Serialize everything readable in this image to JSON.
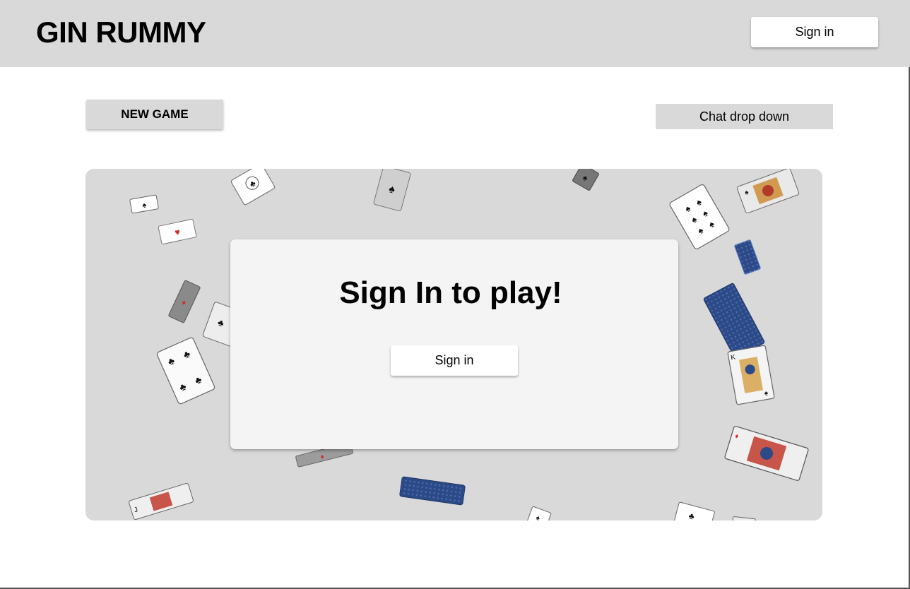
{
  "header": {
    "title": "GIN RUMMY",
    "signin_label": "Sign in",
    "background": "#d9d9d9"
  },
  "toolbar": {
    "new_game_label": "NEW GAME",
    "chat_label": "Chat drop down"
  },
  "main": {
    "prompt_title": "Sign In to play!",
    "signin_label": "Sign in",
    "stage_background": "#d9d9d9",
    "panel_background": "#f4f4f4"
  },
  "decor": {
    "card_suits": [
      "spade",
      "heart",
      "club",
      "diamond"
    ],
    "card_back_color": "#2c4a87",
    "red_suit_color": "#d22b2b",
    "black_suit_color": "#111111"
  }
}
